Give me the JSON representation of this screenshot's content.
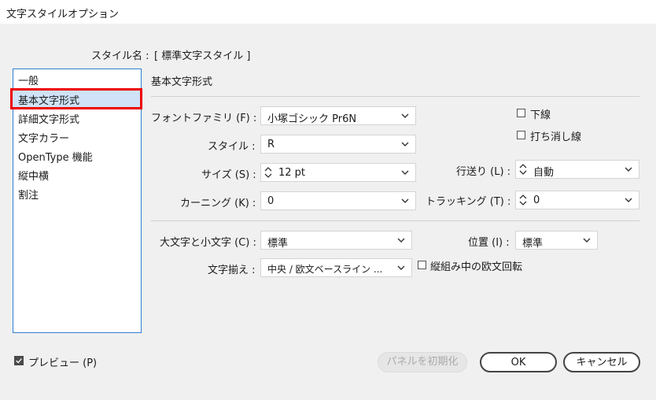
{
  "window": {
    "title": "文字スタイルオプション"
  },
  "style_name": {
    "label": "スタイル名 :",
    "value": "[ 標準文字スタイル ]"
  },
  "sidebar": {
    "items": [
      {
        "label": "一般"
      },
      {
        "label": "基本文字形式"
      },
      {
        "label": "詳細文字形式"
      },
      {
        "label": "文字カラー"
      },
      {
        "label": "OpenType 機能"
      },
      {
        "label": "縦中横"
      },
      {
        "label": "割注"
      }
    ],
    "selected_index": 1
  },
  "section": {
    "title": "基本文字形式"
  },
  "fields": {
    "font_family": {
      "label": "フォントファミリ (F) :",
      "value": "小塚ゴシック Pr6N"
    },
    "style": {
      "label": "スタイル :",
      "value": "R"
    },
    "size": {
      "label": "サイズ (S) :",
      "value": "12 pt"
    },
    "leading": {
      "label": "行送り (L) :",
      "value": "自動"
    },
    "kerning": {
      "label": "カーニング (K) :",
      "value": "0"
    },
    "tracking": {
      "label": "トラッキング (T) :",
      "value": "0"
    },
    "case": {
      "label": "大文字と小文字 (C) :",
      "value": "標準"
    },
    "position": {
      "label": "位置 (I) :",
      "value": "標準"
    },
    "alignment": {
      "label": "文字揃え :",
      "value": "中央 / 欧文ベースライン ..."
    }
  },
  "checkboxes": {
    "underline": {
      "label": "下線",
      "checked": false
    },
    "strikethrough": {
      "label": "打ち消し線",
      "checked": false
    },
    "rotate_roman": {
      "label": "縦組み中の欧文回転",
      "checked": false
    },
    "preview": {
      "label": "プレビュー (P)",
      "checked": true
    }
  },
  "buttons": {
    "reset": "パネルを初期化",
    "ok": "OK",
    "cancel": "キャンセル"
  },
  "colors": {
    "highlight_border": "#e00000",
    "selected_bg": "#cfe2f7",
    "list_border": "#2f7fd1"
  }
}
